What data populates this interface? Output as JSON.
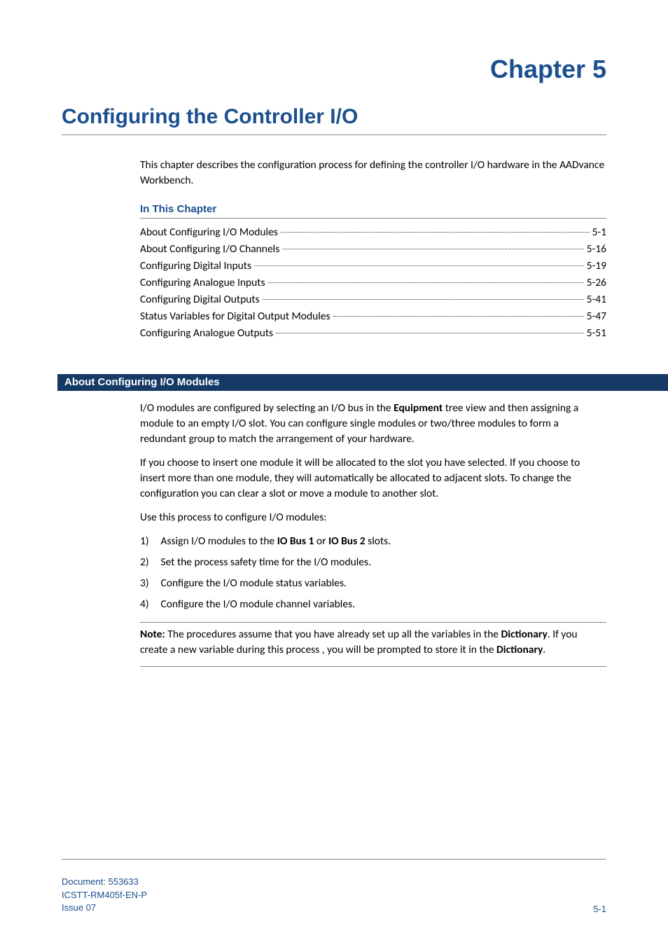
{
  "chapter": {
    "number": "Chapter 5",
    "title": "Configuring the Controller I/O",
    "intro": "This chapter describes the configuration process for defining the controller I/O hardware in the  AADvance Workbench."
  },
  "in_this_chapter": {
    "heading": "In This Chapter",
    "items": [
      {
        "label": "About Configuring I/O Modules",
        "page": "5-1"
      },
      {
        "label": "About Configuring I/O Channels",
        "page": "5-16"
      },
      {
        "label": "Configuring Digital Inputs",
        "page": "5-19"
      },
      {
        "label": "Configuring Analogue Inputs",
        "page": "5-26"
      },
      {
        "label": "Configuring Digital Outputs",
        "page": "5-41"
      },
      {
        "label": "Status Variables for Digital Output Modules",
        "page": "5-47"
      },
      {
        "label": "Configuring Analogue Outputs",
        "page": "5-51"
      }
    ]
  },
  "section": {
    "heading": "About Configuring I/O Modules",
    "p1a": "I/O modules are configured by selecting an I/O bus in the ",
    "p1b": "Equipment",
    "p1c": " tree view and then assigning a module to an empty I/O slot. You can configure single modules or two/three modules to form a redundant group to match the arrangement of your hardware.",
    "p2": "If you choose to insert one module it will be allocated to the slot you have selected. If you choose to insert more than one module, they will automatically be allocated to adjacent slots. To change the configuration you can clear a slot or move a module to another slot.",
    "p3": "Use this process to configure I/O modules:",
    "steps": {
      "s1a": "Assign I/O modules to the ",
      "s1b": "IO Bus 1",
      "s1c": " or ",
      "s1d": "IO Bus 2",
      "s1e": " slots.",
      "s2": "Set the process safety time for the I/O modules.",
      "s3": "Configure the I/O module status variables.",
      "s4": "Configure the I/O module channel variables."
    },
    "nums": {
      "n1": "1)",
      "n2": "2)",
      "n3": "3)",
      "n4": "4)"
    },
    "note": {
      "label": "Note:",
      "a": " The procedures assume that you have already set up all the variables in the ",
      "b": "Dictionary",
      "c": ". If you create a new variable during this process , you will be prompted to store it in the ",
      "d": "Dictionary",
      "e": "."
    }
  },
  "footer": {
    "doc_label": "Document: ",
    "doc_num": "553633",
    "code": "ICSTT-RM405f-EN-P",
    "issue": " Issue 07",
    "page": "5-1"
  }
}
